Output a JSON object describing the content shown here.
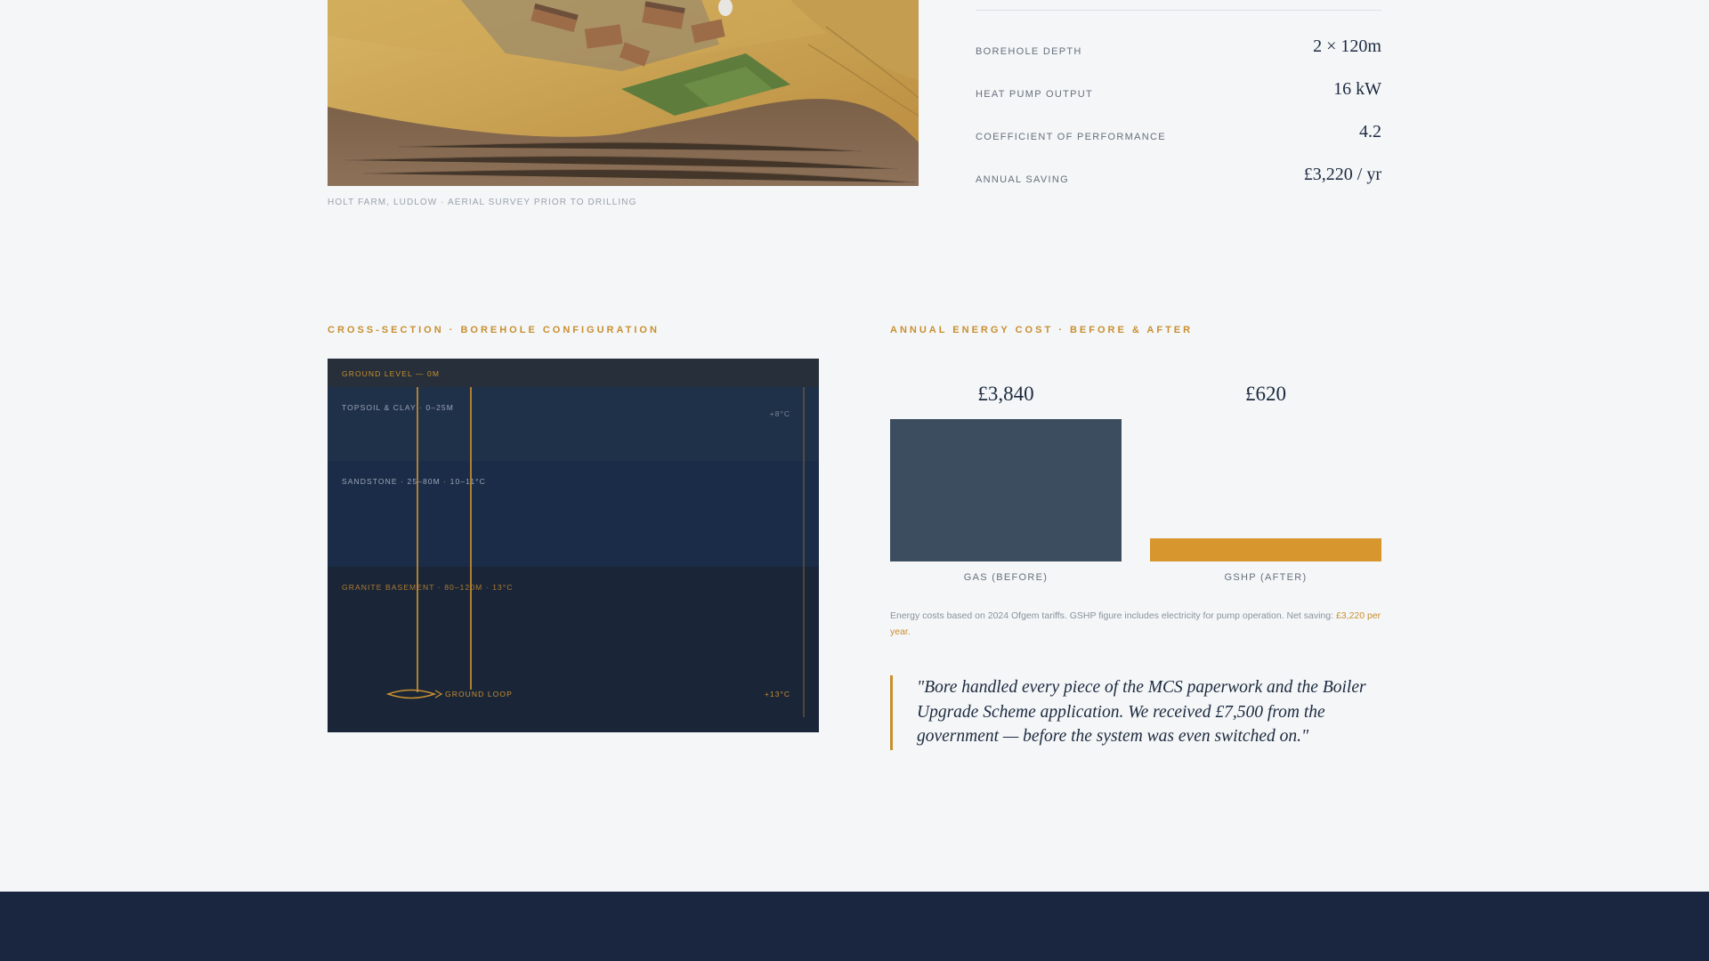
{
  "hero": {
    "caption": "HOLT FARM, LUDLOW · AERIAL SURVEY PRIOR TO DRILLING"
  },
  "specs": [
    {
      "label": "BOREHOLE DEPTH",
      "value": "2 × 120m"
    },
    {
      "label": "HEAT PUMP OUTPUT",
      "value": "16 kW"
    },
    {
      "label": "COEFFICIENT OF PERFORMANCE",
      "value": "4.2"
    },
    {
      "label": "ANNUAL SAVING",
      "value": "£3,220 / yr"
    }
  ],
  "cross_section": {
    "title": "CROSS-SECTION · BOREHOLE CONFIGURATION",
    "ground_level": "GROUND LEVEL — 0M",
    "layers": [
      {
        "label": "TOPSOIL & CLAY · 0–25M",
        "temp": "+8°C"
      },
      {
        "label": "SANDSTONE · 25–80M · 10–11°C"
      },
      {
        "label": "GRANITE BASEMENT · 80–120M · 13°C"
      }
    ],
    "loop_label": "GROUND LOOP",
    "bottom_temp": "+13°C",
    "colors": {
      "surface": "#262f3a",
      "topsoil": "#1f3049",
      "sandstone": "#1b2c48",
      "granite": "#1a2638",
      "pipe": "#c98f2f"
    }
  },
  "energy_cost": {
    "title": "ANNUAL ENERGY COST · BEFORE & AFTER",
    "note_text": "Energy costs based on 2024 Ofgem tariffs. GSHP figure includes electricity for pump operation. Net saving:",
    "note_highlight": "£3,220 per year.",
    "chart_data": {
      "type": "bar",
      "categories": [
        "GAS (BEFORE)",
        "GSHP (AFTER)"
      ],
      "values": [
        3840,
        620
      ],
      "value_labels": [
        "£3,840",
        "£620"
      ],
      "colors": [
        "#3d4d60",
        "#d8962e"
      ]
    }
  },
  "quote": {
    "text": "\"Bore handled every piece of the MCS paperwork and the Boiler Upgrade Scheme application. We received £7,500 from the government — before the system was even switched on.\""
  }
}
